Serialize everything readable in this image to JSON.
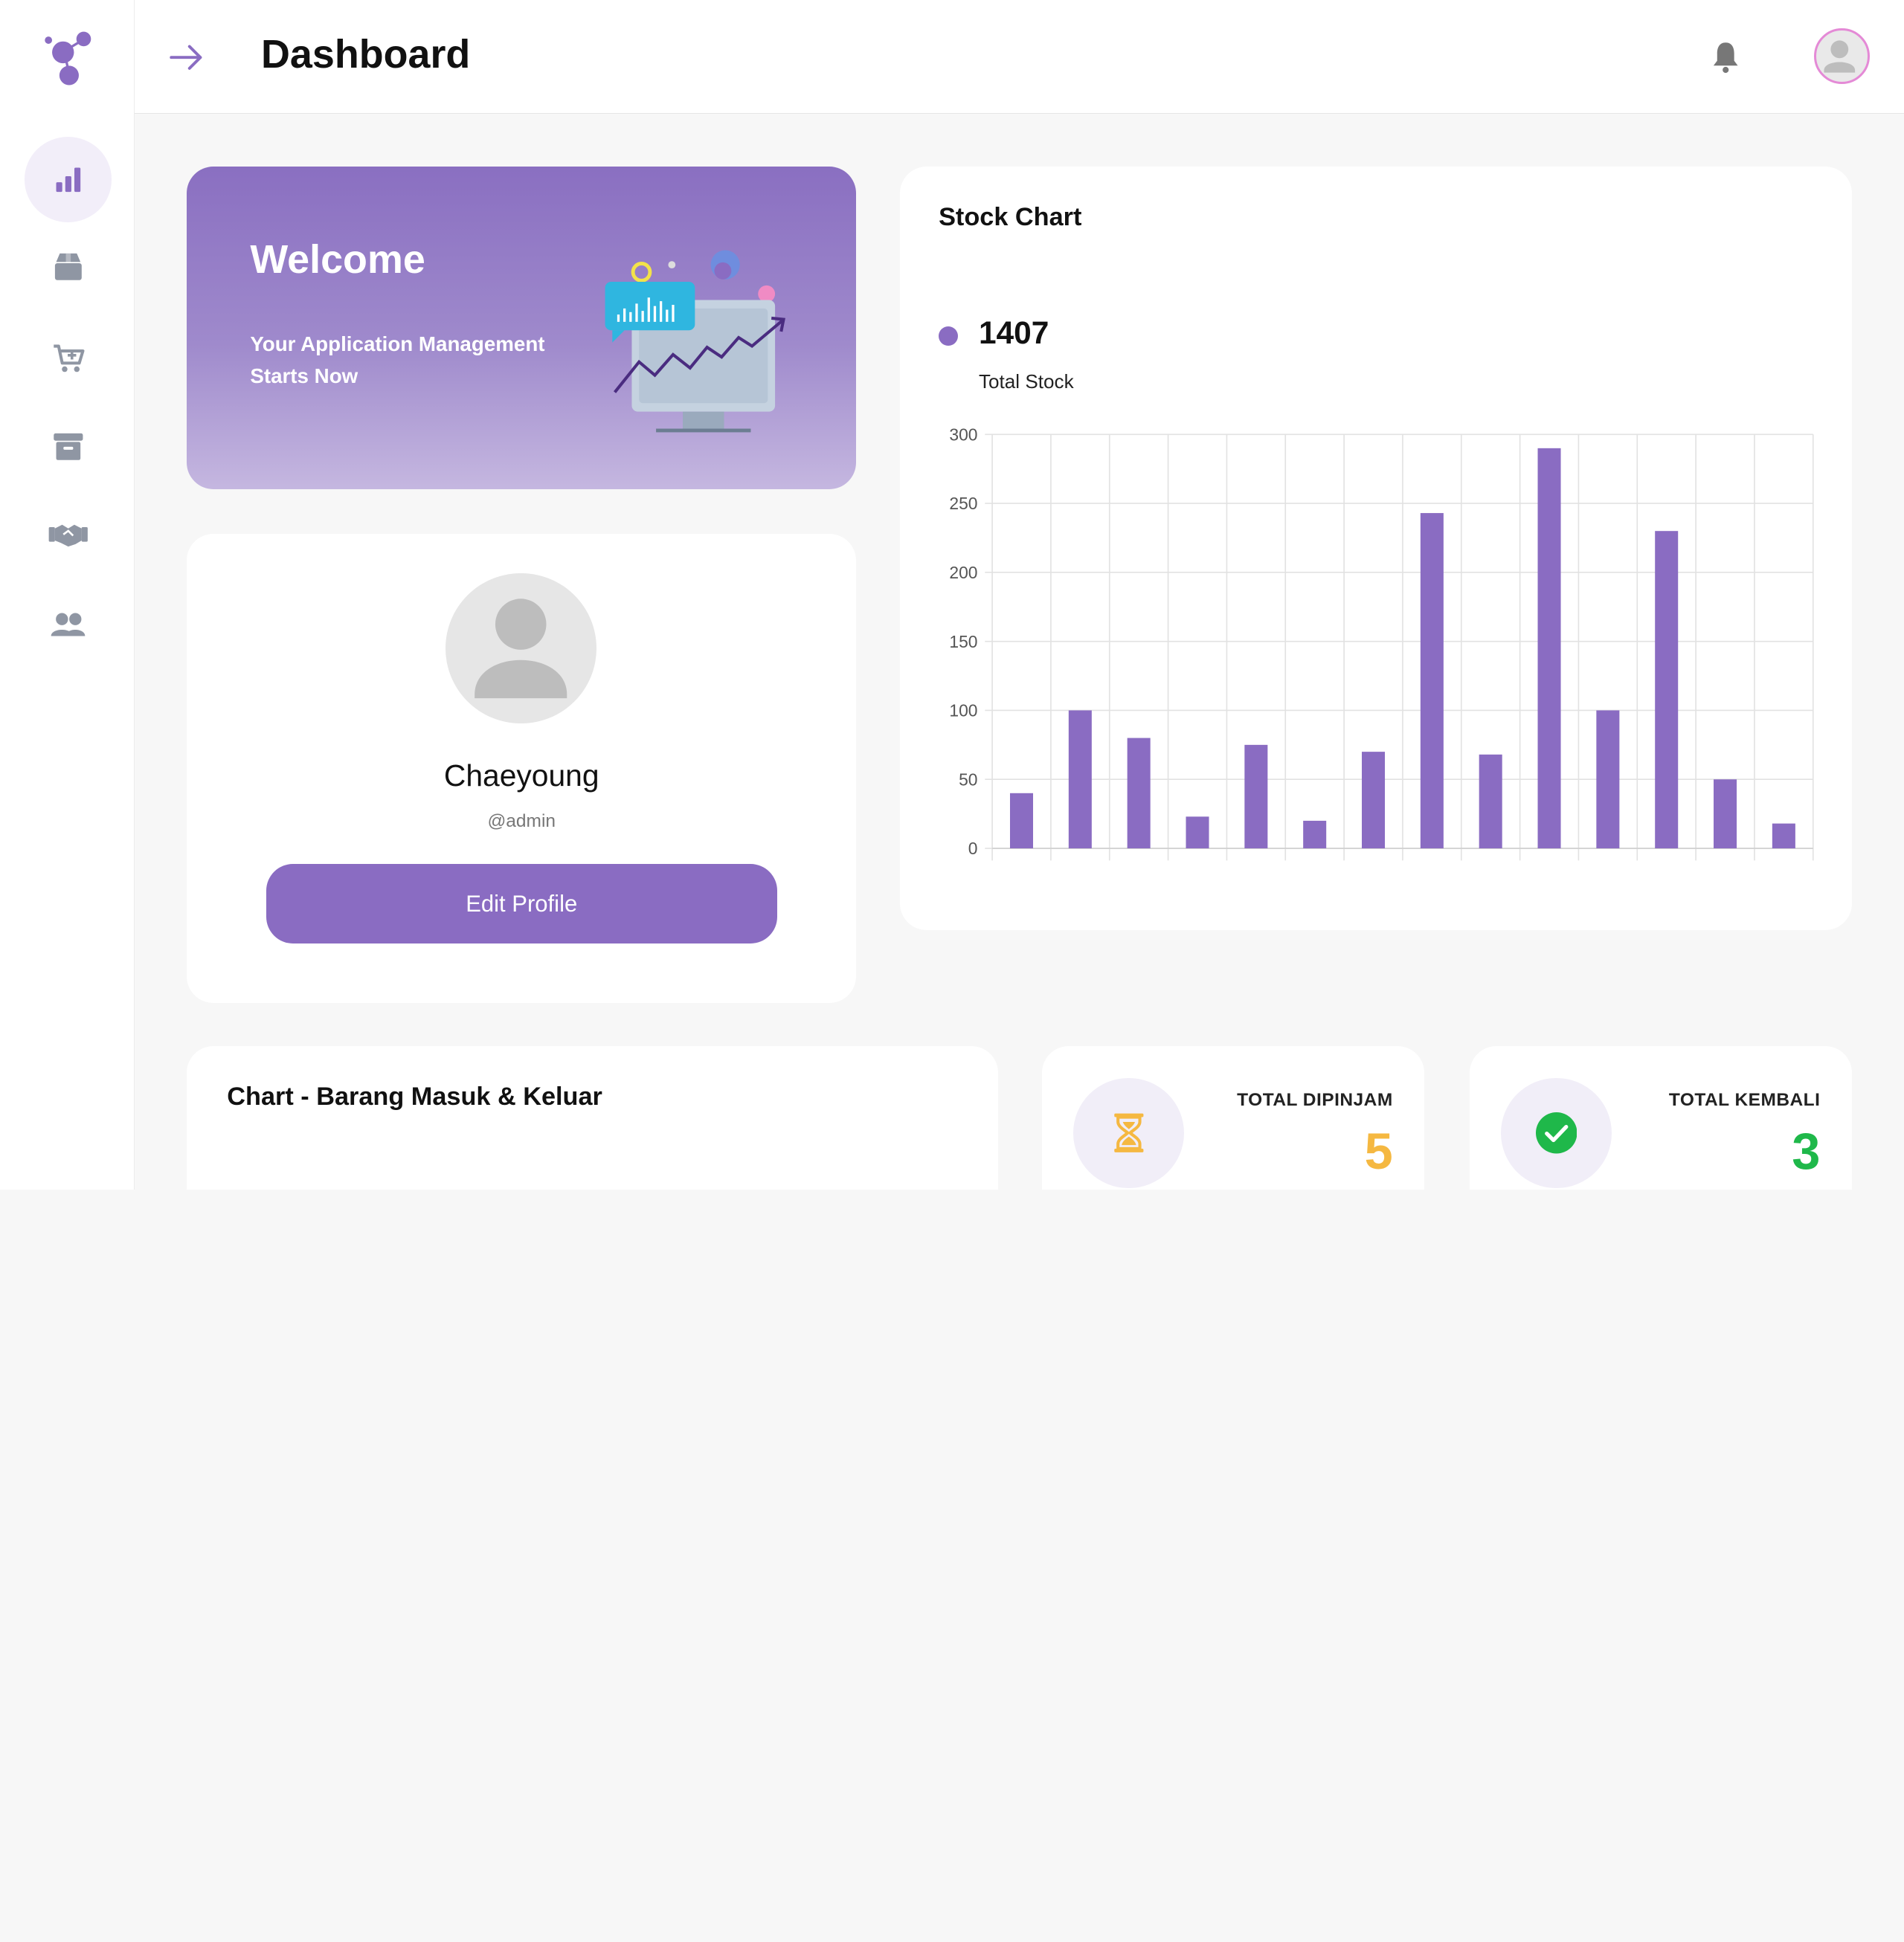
{
  "header": {
    "title": "Dashboard",
    "toggle_icon": "arrow-right-icon",
    "bell_icon": "bell-icon",
    "avatar_icon": "user-avatar-icon"
  },
  "sidebar": {
    "logo_icon": "molecule-logo-icon",
    "items": [
      {
        "icon": "bar-chart-icon",
        "active": true
      },
      {
        "icon": "box-icon",
        "active": false
      },
      {
        "icon": "cart-plus-icon",
        "active": false
      },
      {
        "icon": "archive-icon",
        "active": false
      },
      {
        "icon": "handshake-icon",
        "active": false
      },
      {
        "icon": "users-icon",
        "active": false
      }
    ]
  },
  "welcome": {
    "title": "Welcome",
    "subtitle": "Your Application Management Starts Now"
  },
  "profile": {
    "name": "Chaeyoung",
    "handle": "@admin",
    "edit_label": "Edit Profile"
  },
  "stock": {
    "title": "Stock Chart",
    "total": "1407",
    "total_label": "Total Stock"
  },
  "chart_data": {
    "type": "bar",
    "title": "Stock Chart",
    "categories": [
      "",
      "",
      "",
      "",
      "",
      "",
      "",
      "",
      "",
      "",
      "",
      "",
      "",
      ""
    ],
    "values": [
      40,
      100,
      80,
      23,
      75,
      20,
      70,
      243,
      68,
      290,
      100,
      230,
      50,
      18
    ],
    "ylim": [
      0,
      300
    ],
    "yticks": [
      0,
      50,
      100,
      150,
      200,
      250,
      300
    ],
    "grid": true,
    "color": "#8a6cc2"
  },
  "barang": {
    "title": "Chart - Barang Masuk & Keluar"
  },
  "stats": {
    "dipinjam": {
      "label": "TOTAL DIPINJAM",
      "value": "5",
      "color": "#f5b841",
      "icon": "hourglass-icon"
    },
    "kembali": {
      "label": "TOTAL KEMBALI",
      "value": "3",
      "color": "#1fb84a",
      "icon": "check-circle-icon"
    }
  },
  "colors": {
    "accent": "#8a6cc2",
    "sidebar_icon": "#8f96a3",
    "background": "#f7f7f7"
  }
}
